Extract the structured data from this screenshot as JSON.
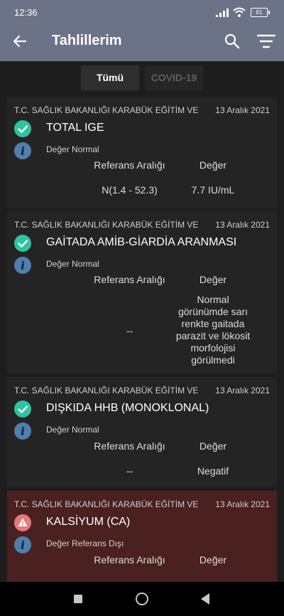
{
  "status": {
    "time": "12:36",
    "battery": "91"
  },
  "header": {
    "title": "Tahlillerim"
  },
  "tabs": [
    {
      "label": "Tümü",
      "active": true
    },
    {
      "label": "COVID-19",
      "active": false
    }
  ],
  "column_labels": {
    "range": "Referans Aralığı",
    "value": "Değer"
  },
  "results": [
    {
      "institution": "T.C. SAĞLIK BAKANLIĞI KARABÜK EĞİTİM VE",
      "date": "13 Aralık 2021",
      "test": "TOTAL IGE",
      "note": "Değer Normal",
      "range": "N(1.4 - 52.3)",
      "value": "7.7 IU/mL",
      "status": "normal"
    },
    {
      "institution": "T.C. SAĞLIK BAKANLIĞI KARABÜK EĞİTİM VE",
      "date": "13 Aralık 2021",
      "test": "GAİTADA AMİB-GİARDİA ARANMASI",
      "note": "Değer Normal",
      "range": "--",
      "value": "Normal görünümde sarı renkte gaitada parazit ve lökosit morfolojisi görülmedi",
      "status": "normal"
    },
    {
      "institution": "T.C. SAĞLIK BAKANLIĞI KARABÜK EĞİTİM VE",
      "date": "13 Aralık 2021",
      "test": "DIŞKIDA HHB (MONOKLONAL)",
      "note": "Değer Normal",
      "range": "--",
      "value": "Negatif",
      "status": "normal"
    },
    {
      "institution": "T.C. SAĞLIK BAKANLIĞI KARABÜK EĞİTİM VE",
      "date": "13 Aralık 2021",
      "test": "KALSİYUM (CA)",
      "note": "Değer Referans Dışı",
      "status": "alert"
    }
  ],
  "colors": {
    "appbar": "#6d7386",
    "ok": "#2ec4a0",
    "alert": "#e8797a",
    "info": "#4d7fb0",
    "alert_card": "#4a2120"
  }
}
